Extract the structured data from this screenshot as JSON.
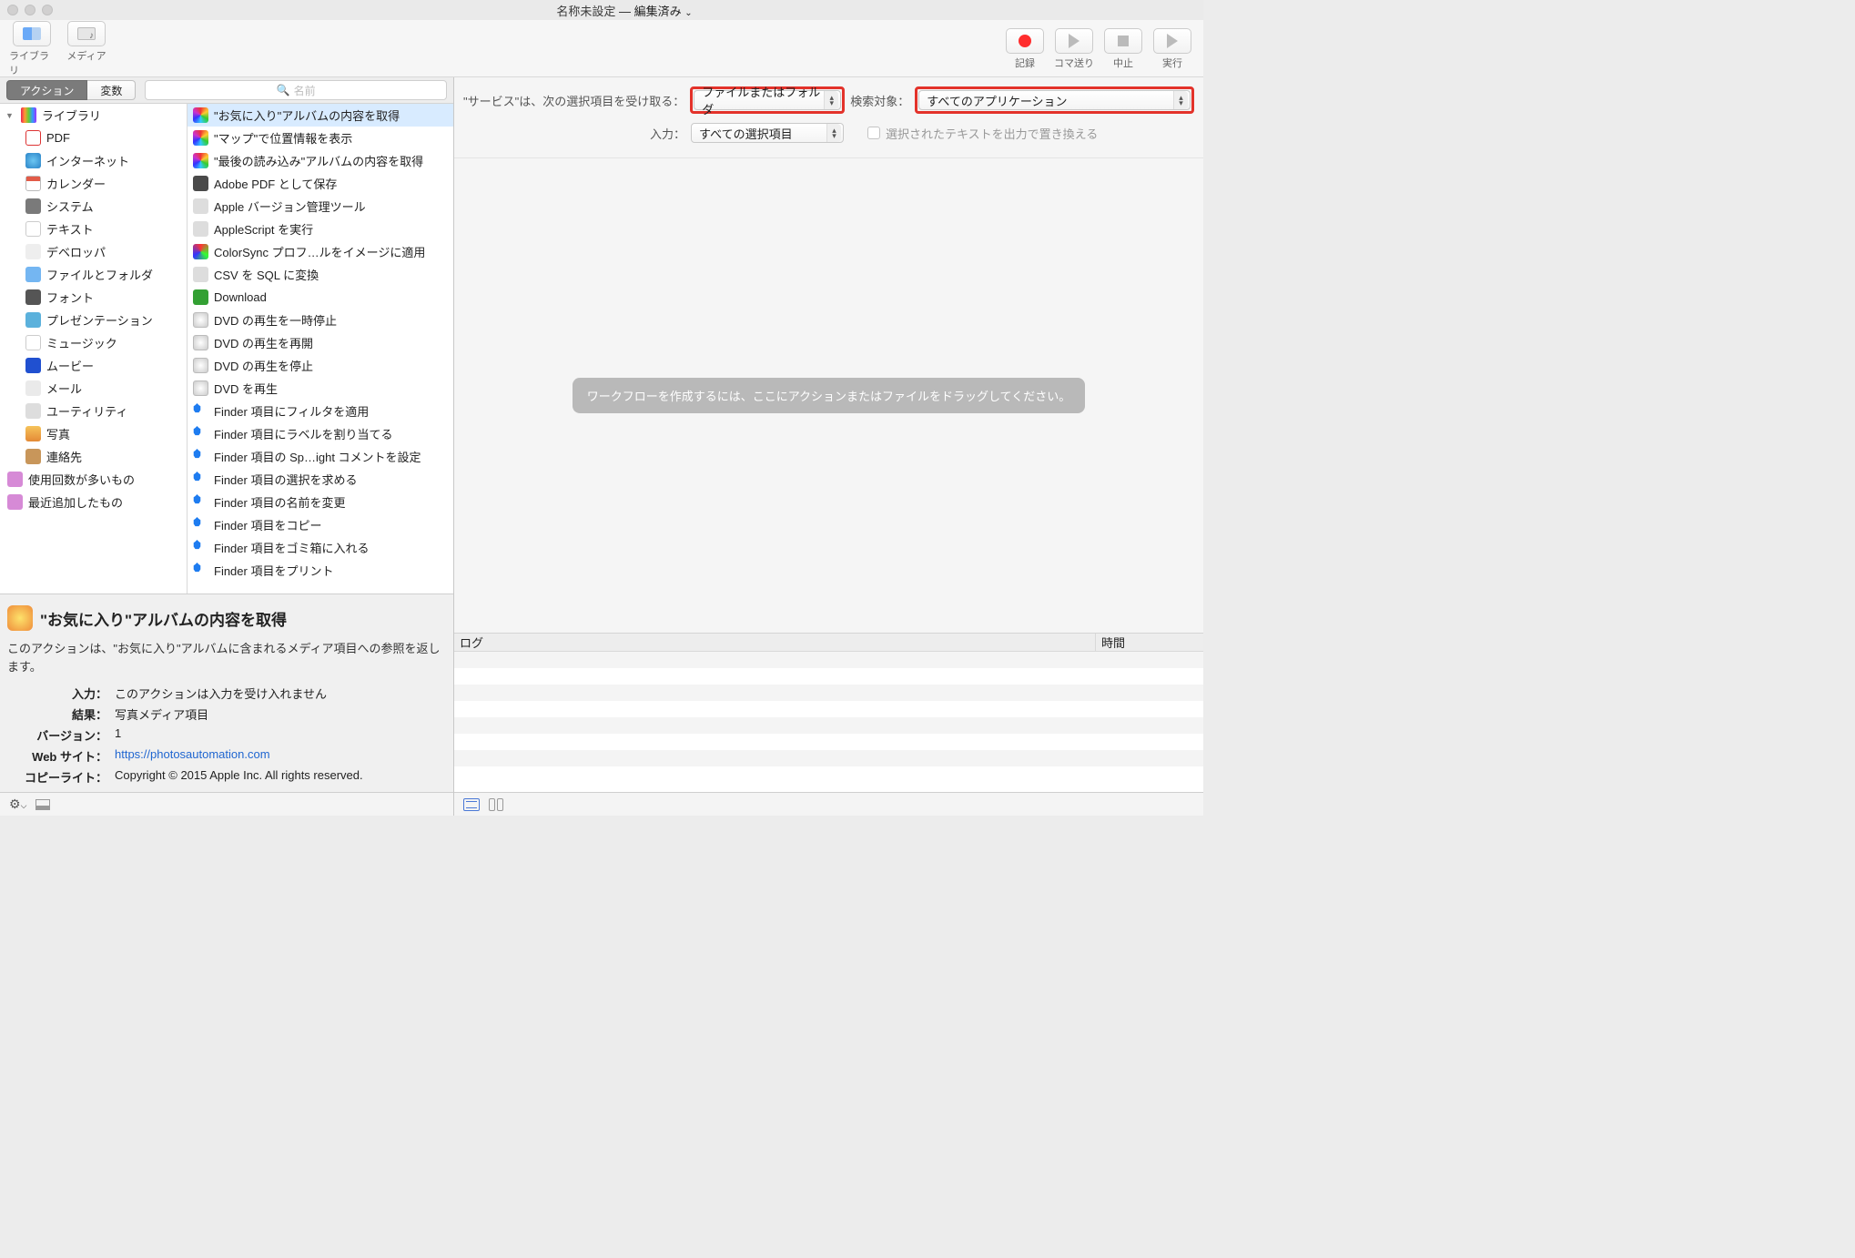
{
  "title": {
    "name": "名称未設定",
    "sep": " — ",
    "edited": "編集済み"
  },
  "toolbar": {
    "library": "ライブラリ",
    "media": "メディア",
    "record": "記録",
    "step": "コマ送り",
    "stop": "中止",
    "run": "実行"
  },
  "tabs": {
    "actions": "アクション",
    "vars": "変数"
  },
  "search": {
    "placeholder": "名前"
  },
  "library": {
    "header": "ライブラリ"
  },
  "categories": [
    {
      "label": "PDF",
      "ic": "ic-pdf"
    },
    {
      "label": "インターネット",
      "ic": "ic-globe"
    },
    {
      "label": "カレンダー",
      "ic": "ic-cal"
    },
    {
      "label": "システム",
      "ic": "ic-sys"
    },
    {
      "label": "テキスト",
      "ic": "ic-txt"
    },
    {
      "label": "デベロッパ",
      "ic": "ic-dev"
    },
    {
      "label": "ファイルとフォルダ",
      "ic": "ic-fold"
    },
    {
      "label": "フォント",
      "ic": "ic-font"
    },
    {
      "label": "プレゼンテーション",
      "ic": "ic-pres"
    },
    {
      "label": "ミュージック",
      "ic": "ic-music"
    },
    {
      "label": "ムービー",
      "ic": "ic-mov"
    },
    {
      "label": "メール",
      "ic": "ic-mail"
    },
    {
      "label": "ユーティリティ",
      "ic": "ic-util"
    },
    {
      "label": "写真",
      "ic": "ic-photo"
    },
    {
      "label": "連絡先",
      "ic": "ic-cont"
    }
  ],
  "smart": [
    {
      "label": "使用回数が多いもの"
    },
    {
      "label": "最近追加したもの"
    }
  ],
  "actions": [
    {
      "label": "\"お気に入り\"アルバムの内容を取得",
      "ic": "ic-colorwheel",
      "selected": true
    },
    {
      "label": "\"マップ\"で位置情報を表示",
      "ic": "ic-colorwheel"
    },
    {
      "label": "\"最後の読み込み\"アルバムの内容を取得",
      "ic": "ic-colorwheel"
    },
    {
      "label": "Adobe PDF として保存",
      "ic": "ic-adobe"
    },
    {
      "label": "Apple バージョン管理ツール",
      "ic": "ic-gear"
    },
    {
      "label": "AppleScript を実行",
      "ic": "ic-script"
    },
    {
      "label": "ColorSync プロフ…ルをイメージに適用",
      "ic": "ic-color"
    },
    {
      "label": "CSV を SQL に変換",
      "ic": "ic-x"
    },
    {
      "label": "Download",
      "ic": "ic-dl"
    },
    {
      "label": "DVD の再生を一時停止",
      "ic": "ic-dvd"
    },
    {
      "label": "DVD の再生を再開",
      "ic": "ic-dvd"
    },
    {
      "label": "DVD の再生を停止",
      "ic": "ic-dvd"
    },
    {
      "label": "DVD を再生",
      "ic": "ic-dvd"
    },
    {
      "label": "Finder 項目にフィルタを適用",
      "ic": "ic-appleblue"
    },
    {
      "label": "Finder 項目にラベルを割り当てる",
      "ic": "ic-appleblue"
    },
    {
      "label": "Finder 項目の Sp…ight コメントを設定",
      "ic": "ic-appleblue"
    },
    {
      "label": "Finder 項目の選択を求める",
      "ic": "ic-appleblue"
    },
    {
      "label": "Finder 項目の名前を変更",
      "ic": "ic-appleblue"
    },
    {
      "label": "Finder 項目をコピー",
      "ic": "ic-appleblue"
    },
    {
      "label": "Finder 項目をゴミ箱に入れる",
      "ic": "ic-appleblue"
    },
    {
      "label": "Finder 項目をプリント",
      "ic": "ic-appleblue"
    }
  ],
  "info": {
    "title": "\"お気に入り\"アルバムの内容を取得",
    "desc": "このアクションは、\"お気に入り\"アルバムに含まれるメディア項目への参照を返します。",
    "keys": {
      "input": "入力：",
      "result": "結果：",
      "version": "バージョン：",
      "website": "Web サイト：",
      "copyright": "コピーライト："
    },
    "vals": {
      "input": "このアクションは入力を受け入れません",
      "result": "写真メディア項目",
      "version": "1",
      "website": "https://photosautomation.com",
      "copyright": "Copyright © 2015 Apple Inc. All rights reserved."
    }
  },
  "config": {
    "serviceReceives": "\"サービス\"は、次の選択項目を受け取る：",
    "receiveValue": "ファイルまたはフォルダ",
    "searchIn": "検索対象：",
    "searchInValue": "すべてのアプリケーション",
    "inputLabel": "入力：",
    "inputValue": "すべての選択項目",
    "replace": "選択されたテキストを出力で置き換える"
  },
  "canvas": {
    "drop": "ワークフローを作成するには、ここにアクションまたはファイルをドラッグしてください。"
  },
  "log": {
    "col1": "ログ",
    "col2": "時間"
  }
}
